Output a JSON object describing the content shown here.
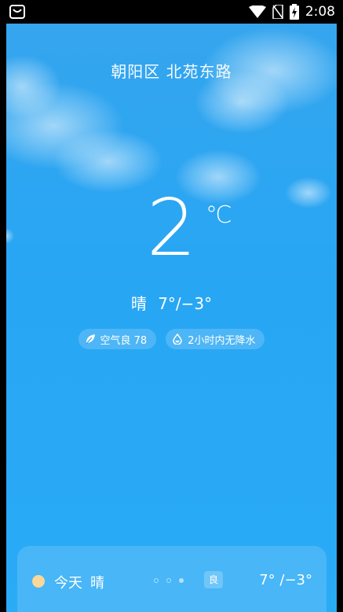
{
  "status_bar": {
    "time": "2:08",
    "icons": [
      "notification-icon",
      "wifi-icon",
      "no-sim-icon",
      "battery-charging-icon"
    ]
  },
  "weather": {
    "location": "朝阳区 北苑东路",
    "temperature": "2",
    "unit": "℃",
    "condition": "晴",
    "range": "7°/−3°",
    "air_quality": {
      "icon": "leaf-icon",
      "label": "空气良 78"
    },
    "precipitation": {
      "icon": "raindrop-icon",
      "label": "2小时内无降水"
    }
  },
  "forecast": {
    "today": {
      "icon": "sun-dot-icon",
      "day": "今天",
      "condition": "晴",
      "aqi": "良",
      "range": "7° /−3°"
    },
    "page_count": 3,
    "active_page": 3
  },
  "colors": {
    "sky_top": "#35a5ee",
    "sky_bottom": "#2aabf6",
    "sun": "#f9d89a"
  }
}
